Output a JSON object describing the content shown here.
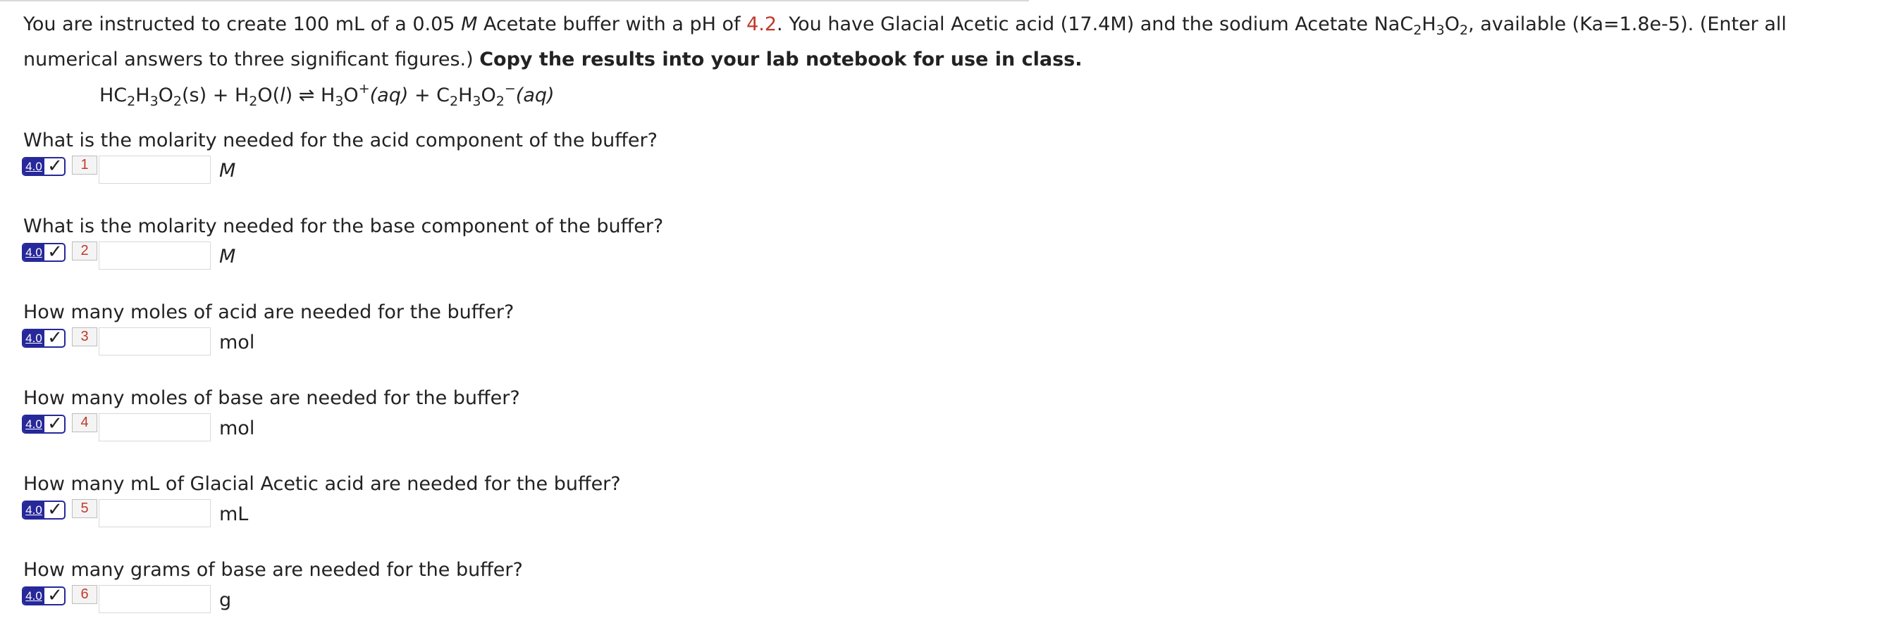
{
  "intro": {
    "part1": "You are instructed to create 100 mL of a 0.05 ",
    "molar_symbol": "M",
    "part2": " Acetate buffer with a pH of ",
    "ph_value": "4.2",
    "part3": ". You have Glacial Acetic acid (17.4M) and the sodium Acetate NaC",
    "part4": ", available (Ka=1.8e-5). (Enter all numerical answers to three significant figures.) ",
    "bold_instruction": "Copy the results into your lab notebook for use in class."
  },
  "equation": {
    "reactant": "HC",
    "reactant_state": "(s)",
    "plus1": " + H",
    "water": "O(",
    "water_state": "l",
    "water_close": ")",
    "arrow": "⇌",
    "product1": "H",
    "product1_b": "O",
    "product1_charge": "+",
    "product1_state": "(aq)",
    "plus2": " + C",
    "product2_charge": "−",
    "product2_state": "(aq)"
  },
  "questions": [
    {
      "text": "What is the molarity needed for the acid component of the buffer?",
      "points": "4.0",
      "number": "1",
      "value": "",
      "unit": "M",
      "unit_italic": true
    },
    {
      "text": "What is the molarity needed for the base component of the buffer?",
      "points": "4.0",
      "number": "2",
      "value": "",
      "unit": "M",
      "unit_italic": true
    },
    {
      "text": "How many moles of acid are needed for the buffer?",
      "points": "4.0",
      "number": "3",
      "value": "",
      "unit": "mol",
      "unit_italic": false
    },
    {
      "text": "How many moles of base are needed for the buffer?",
      "points": "4.0",
      "number": "4",
      "value": "",
      "unit": "mol",
      "unit_italic": false
    },
    {
      "text": "How many mL of Glacial Acetic acid are needed for the buffer?",
      "points": "4.0",
      "number": "5",
      "value": "",
      "unit": "mL",
      "unit_italic": false
    },
    {
      "text": "How many grams of base are needed for the buffer?",
      "points": "4.0",
      "number": "6",
      "value": "",
      "unit": "g",
      "unit_italic": false
    }
  ],
  "icons": {
    "check": "checkmark-icon"
  },
  "colors": {
    "ph_highlight": "#c0392b",
    "badge_blue": "#27289a",
    "number_badge_text": "#c0392b"
  }
}
